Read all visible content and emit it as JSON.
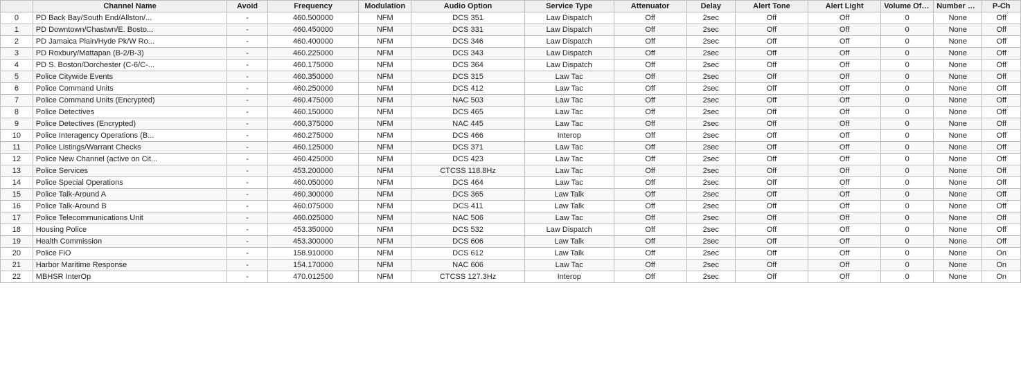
{
  "table": {
    "columns": [
      {
        "key": "idx",
        "label": ""
      },
      {
        "key": "channel_name",
        "label": "Channel Name"
      },
      {
        "key": "avoid",
        "label": "Avoid"
      },
      {
        "key": "frequency",
        "label": "Frequency"
      },
      {
        "key": "modulation",
        "label": "Modulation"
      },
      {
        "key": "audio_option",
        "label": "Audio Option"
      },
      {
        "key": "service_type",
        "label": "Service Type"
      },
      {
        "key": "attenuator",
        "label": "Attenuator"
      },
      {
        "key": "delay",
        "label": "Delay"
      },
      {
        "key": "alert_tone",
        "label": "Alert Tone"
      },
      {
        "key": "alert_light",
        "label": "Alert Light"
      },
      {
        "key": "volume_offset",
        "label": "Volume Offset"
      },
      {
        "key": "number_tag",
        "label": "Number Tag"
      },
      {
        "key": "p_ch",
        "label": "P-Ch"
      }
    ],
    "rows": [
      {
        "idx": "0",
        "channel_name": "PD Back Bay/South End/Allston/...",
        "avoid": "-",
        "frequency": "460.500000",
        "modulation": "NFM",
        "audio_option": "DCS 351",
        "service_type": "Law Dispatch",
        "attenuator": "Off",
        "delay": "2sec",
        "alert_tone": "Off",
        "alert_light": "Off",
        "volume_offset": "0",
        "number_tag": "None",
        "p_ch": "Off"
      },
      {
        "idx": "1",
        "channel_name": "PD Downtown/Chastwn/E. Bosto...",
        "avoid": "-",
        "frequency": "460.450000",
        "modulation": "NFM",
        "audio_option": "DCS 331",
        "service_type": "Law Dispatch",
        "attenuator": "Off",
        "delay": "2sec",
        "alert_tone": "Off",
        "alert_light": "Off",
        "volume_offset": "0",
        "number_tag": "None",
        "p_ch": "Off"
      },
      {
        "idx": "2",
        "channel_name": "PD Jamaica Plain/Hyde Pk/W Ro...",
        "avoid": "-",
        "frequency": "460.400000",
        "modulation": "NFM",
        "audio_option": "DCS 346",
        "service_type": "Law Dispatch",
        "attenuator": "Off",
        "delay": "2sec",
        "alert_tone": "Off",
        "alert_light": "Off",
        "volume_offset": "0",
        "number_tag": "None",
        "p_ch": "Off"
      },
      {
        "idx": "3",
        "channel_name": "PD Roxbury/Mattapan (B-2/B-3)",
        "avoid": "-",
        "frequency": "460.225000",
        "modulation": "NFM",
        "audio_option": "DCS 343",
        "service_type": "Law Dispatch",
        "attenuator": "Off",
        "delay": "2sec",
        "alert_tone": "Off",
        "alert_light": "Off",
        "volume_offset": "0",
        "number_tag": "None",
        "p_ch": "Off"
      },
      {
        "idx": "4",
        "channel_name": "PD S. Boston/Dorchester (C-6/C-...",
        "avoid": "-",
        "frequency": "460.175000",
        "modulation": "NFM",
        "audio_option": "DCS 364",
        "service_type": "Law Dispatch",
        "attenuator": "Off",
        "delay": "2sec",
        "alert_tone": "Off",
        "alert_light": "Off",
        "volume_offset": "0",
        "number_tag": "None",
        "p_ch": "Off"
      },
      {
        "idx": "5",
        "channel_name": "Police Citywide Events",
        "avoid": "-",
        "frequency": "460.350000",
        "modulation": "NFM",
        "audio_option": "DCS 315",
        "service_type": "Law Tac",
        "attenuator": "Off",
        "delay": "2sec",
        "alert_tone": "Off",
        "alert_light": "Off",
        "volume_offset": "0",
        "number_tag": "None",
        "p_ch": "Off"
      },
      {
        "idx": "6",
        "channel_name": "Police Command Units",
        "avoid": "-",
        "frequency": "460.250000",
        "modulation": "NFM",
        "audio_option": "DCS 412",
        "service_type": "Law Tac",
        "attenuator": "Off",
        "delay": "2sec",
        "alert_tone": "Off",
        "alert_light": "Off",
        "volume_offset": "0",
        "number_tag": "None",
        "p_ch": "Off"
      },
      {
        "idx": "7",
        "channel_name": "Police Command Units (Encrypted)",
        "avoid": "-",
        "frequency": "460.475000",
        "modulation": "NFM",
        "audio_option": "NAC 503",
        "service_type": "Law Tac",
        "attenuator": "Off",
        "delay": "2sec",
        "alert_tone": "Off",
        "alert_light": "Off",
        "volume_offset": "0",
        "number_tag": "None",
        "p_ch": "Off"
      },
      {
        "idx": "8",
        "channel_name": "Police Detectives",
        "avoid": "-",
        "frequency": "460.150000",
        "modulation": "NFM",
        "audio_option": "DCS 465",
        "service_type": "Law Tac",
        "attenuator": "Off",
        "delay": "2sec",
        "alert_tone": "Off",
        "alert_light": "Off",
        "volume_offset": "0",
        "number_tag": "None",
        "p_ch": "Off"
      },
      {
        "idx": "9",
        "channel_name": "Police Detectives (Encrypted)",
        "avoid": "-",
        "frequency": "460.375000",
        "modulation": "NFM",
        "audio_option": "NAC 445",
        "service_type": "Law Tac",
        "attenuator": "Off",
        "delay": "2sec",
        "alert_tone": "Off",
        "alert_light": "Off",
        "volume_offset": "0",
        "number_tag": "None",
        "p_ch": "Off"
      },
      {
        "idx": "10",
        "channel_name": "Police Interagency Operations (B...",
        "avoid": "-",
        "frequency": "460.275000",
        "modulation": "NFM",
        "audio_option": "DCS 466",
        "service_type": "Interop",
        "attenuator": "Off",
        "delay": "2sec",
        "alert_tone": "Off",
        "alert_light": "Off",
        "volume_offset": "0",
        "number_tag": "None",
        "p_ch": "Off"
      },
      {
        "idx": "11",
        "channel_name": "Police Listings/Warrant Checks",
        "avoid": "-",
        "frequency": "460.125000",
        "modulation": "NFM",
        "audio_option": "DCS 371",
        "service_type": "Law Tac",
        "attenuator": "Off",
        "delay": "2sec",
        "alert_tone": "Off",
        "alert_light": "Off",
        "volume_offset": "0",
        "number_tag": "None",
        "p_ch": "Off"
      },
      {
        "idx": "12",
        "channel_name": "Police New Channel (active on Cit...",
        "avoid": "-",
        "frequency": "460.425000",
        "modulation": "NFM",
        "audio_option": "DCS 423",
        "service_type": "Law Tac",
        "attenuator": "Off",
        "delay": "2sec",
        "alert_tone": "Off",
        "alert_light": "Off",
        "volume_offset": "0",
        "number_tag": "None",
        "p_ch": "Off"
      },
      {
        "idx": "13",
        "channel_name": "Police Services",
        "avoid": "-",
        "frequency": "453.200000",
        "modulation": "NFM",
        "audio_option": "CTCSS 118.8Hz",
        "service_type": "Law Tac",
        "attenuator": "Off",
        "delay": "2sec",
        "alert_tone": "Off",
        "alert_light": "Off",
        "volume_offset": "0",
        "number_tag": "None",
        "p_ch": "Off"
      },
      {
        "idx": "14",
        "channel_name": "Police Special Operations",
        "avoid": "-",
        "frequency": "460.050000",
        "modulation": "NFM",
        "audio_option": "DCS 464",
        "service_type": "Law Tac",
        "attenuator": "Off",
        "delay": "2sec",
        "alert_tone": "Off",
        "alert_light": "Off",
        "volume_offset": "0",
        "number_tag": "None",
        "p_ch": "Off"
      },
      {
        "idx": "15",
        "channel_name": "Police Talk-Around A",
        "avoid": "-",
        "frequency": "460.300000",
        "modulation": "NFM",
        "audio_option": "DCS 365",
        "service_type": "Law Talk",
        "attenuator": "Off",
        "delay": "2sec",
        "alert_tone": "Off",
        "alert_light": "Off",
        "volume_offset": "0",
        "number_tag": "None",
        "p_ch": "Off"
      },
      {
        "idx": "16",
        "channel_name": "Police Talk-Around B",
        "avoid": "-",
        "frequency": "460.075000",
        "modulation": "NFM",
        "audio_option": "DCS 411",
        "service_type": "Law Talk",
        "attenuator": "Off",
        "delay": "2sec",
        "alert_tone": "Off",
        "alert_light": "Off",
        "volume_offset": "0",
        "number_tag": "None",
        "p_ch": "Off"
      },
      {
        "idx": "17",
        "channel_name": "Police Telecommunications Unit",
        "avoid": "-",
        "frequency": "460.025000",
        "modulation": "NFM",
        "audio_option": "NAC 506",
        "service_type": "Law Tac",
        "attenuator": "Off",
        "delay": "2sec",
        "alert_tone": "Off",
        "alert_light": "Off",
        "volume_offset": "0",
        "number_tag": "None",
        "p_ch": "Off"
      },
      {
        "idx": "18",
        "channel_name": "Housing Police",
        "avoid": "-",
        "frequency": "453.350000",
        "modulation": "NFM",
        "audio_option": "DCS 532",
        "service_type": "Law Dispatch",
        "attenuator": "Off",
        "delay": "2sec",
        "alert_tone": "Off",
        "alert_light": "Off",
        "volume_offset": "0",
        "number_tag": "None",
        "p_ch": "Off"
      },
      {
        "idx": "19",
        "channel_name": "Health Commission",
        "avoid": "-",
        "frequency": "453.300000",
        "modulation": "NFM",
        "audio_option": "DCS 606",
        "service_type": "Law Talk",
        "attenuator": "Off",
        "delay": "2sec",
        "alert_tone": "Off",
        "alert_light": "Off",
        "volume_offset": "0",
        "number_tag": "None",
        "p_ch": "Off"
      },
      {
        "idx": "20",
        "channel_name": "Police FiO",
        "avoid": "-",
        "frequency": "158.910000",
        "modulation": "NFM",
        "audio_option": "DCS 612",
        "service_type": "Law Talk",
        "attenuator": "Off",
        "delay": "2sec",
        "alert_tone": "Off",
        "alert_light": "Off",
        "volume_offset": "0",
        "number_tag": "None",
        "p_ch": "On"
      },
      {
        "idx": "21",
        "channel_name": "Harbor Maritime Response",
        "avoid": "-",
        "frequency": "154.170000",
        "modulation": "NFM",
        "audio_option": "NAC 606",
        "service_type": "Law Tac",
        "attenuator": "Off",
        "delay": "2sec",
        "alert_tone": "Off",
        "alert_light": "Off",
        "volume_offset": "0",
        "number_tag": "None",
        "p_ch": "On"
      },
      {
        "idx": "22",
        "channel_name": "MBHSR InterOp",
        "avoid": "-",
        "frequency": "470.012500",
        "modulation": "NFM",
        "audio_option": "CTCSS 127.3Hz",
        "service_type": "Interop",
        "attenuator": "Off",
        "delay": "2sec",
        "alert_tone": "Off",
        "alert_light": "Off",
        "volume_offset": "0",
        "number_tag": "None",
        "p_ch": "On"
      }
    ]
  }
}
